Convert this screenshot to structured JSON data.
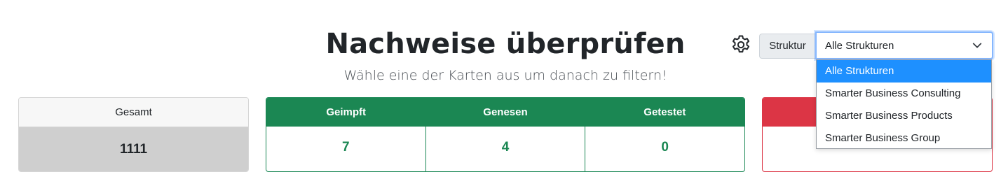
{
  "header": {
    "title": "Nachweise überprüfen",
    "subtitle": "Wähle eine der Karten aus um danach zu filtern!"
  },
  "toolbar": {
    "settings_icon": "gear-icon",
    "struktur_label": "Struktur",
    "select_value": "Alle Strukturen",
    "select_icon": "chevron-down-icon",
    "options": [
      "Alle Strukturen",
      "Smarter Business Consulting",
      "Smarter Business Products",
      "Smarter Business Group"
    ],
    "selected_index": 0
  },
  "cards": {
    "total": {
      "label": "Gesamt",
      "value": "1111"
    },
    "green": [
      {
        "label": "Geimpft",
        "value": "7"
      },
      {
        "label": "Genesen",
        "value": "4"
      },
      {
        "label": "Getestet",
        "value": "0"
      }
    ]
  },
  "colors": {
    "green": "#1b8753",
    "red": "#dc3545",
    "total_bg": "#cfcfcf",
    "option_highlight": "#1e90ff"
  }
}
